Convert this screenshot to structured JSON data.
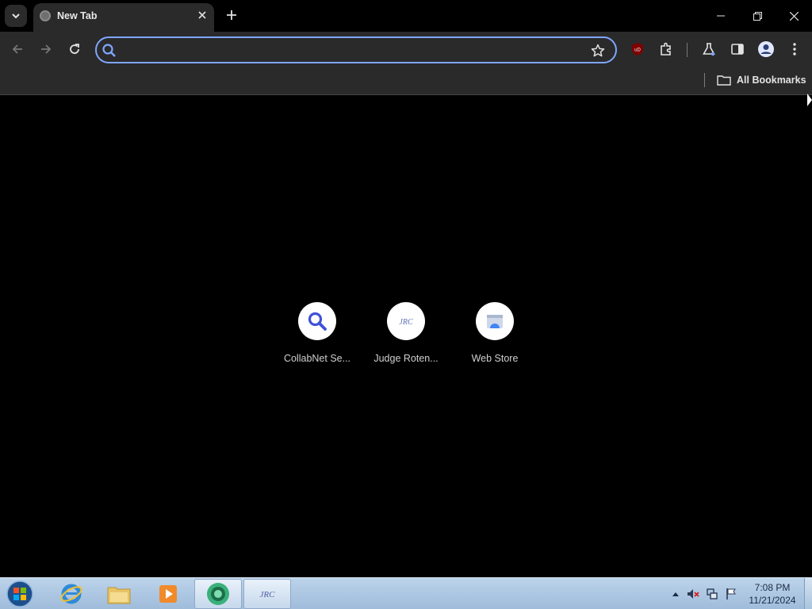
{
  "browser": {
    "tab": {
      "title": "New Tab"
    },
    "omnibox": {
      "value": "",
      "placeholder": ""
    },
    "bookmarks_bar": {
      "all_bookmarks_label": "All Bookmarks"
    },
    "extension_badge": "uD"
  },
  "shortcuts": [
    {
      "label": "CollabNet Se...",
      "icon": "search-icon"
    },
    {
      "label": "Judge Roten...",
      "icon": "jrc-logo-icon",
      "logo_text": "JRC"
    },
    {
      "label": "Web Store",
      "icon": "web-store-icon"
    }
  ],
  "taskbar": {
    "pinned": [
      "internet-explorer-icon",
      "file-explorer-icon",
      "media-player-icon",
      "chrome-icon",
      "jrc-app-icon"
    ],
    "jrc_logo_text": "JRC",
    "clock": {
      "time": "7:08 PM",
      "date": "11/21/2024"
    }
  },
  "colors": {
    "omnibox_focus": "#7fa6ff",
    "toolbar_bg": "#2a2a2a",
    "content_bg": "#000000",
    "search_accent": "#3f51d8"
  }
}
